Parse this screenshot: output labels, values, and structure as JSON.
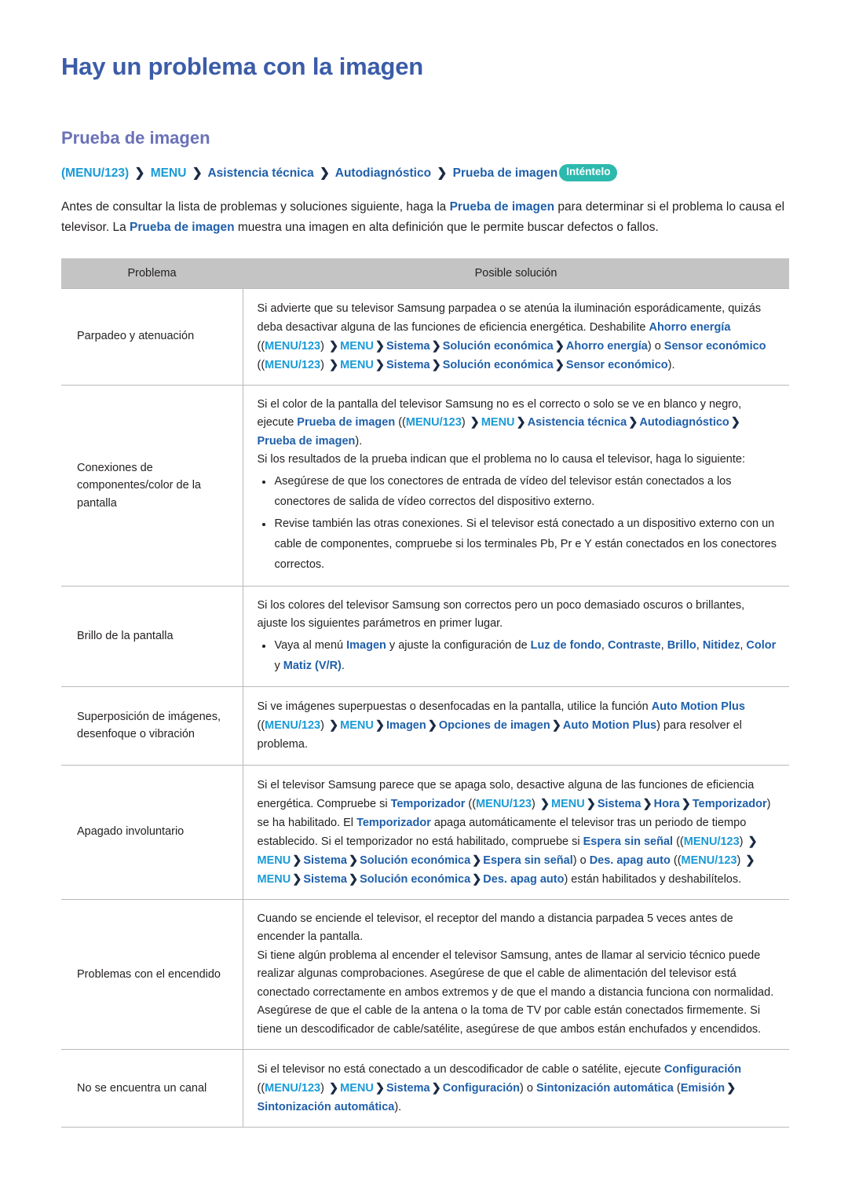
{
  "page": {
    "title": "Hay un problema con la imagen",
    "section_title": "Prueba de imagen"
  },
  "colors": {
    "title_blue": "#3b5ca8",
    "section_purple": "#6b72b8",
    "menu_teal": "#1a9bd7",
    "menu_blue": "#1f5faa",
    "badge_teal": "#2cb9ae",
    "table_header_gray": "#c4c4c4",
    "border_gray": "#b9b9b9"
  },
  "breadcrumb": {
    "menu123": "(MENU/123)",
    "menu": "MENU",
    "items": [
      "Asistencia técnica",
      "Autodiagnóstico",
      "Prueba de imagen"
    ],
    "chevron": "❯",
    "badge": "Inténtelo"
  },
  "intro": {
    "part1": "Antes de consultar la lista de problemas y soluciones siguiente, haga la ",
    "bold1": "Prueba de imagen",
    "part2": " para determinar si el problema lo causa el televisor. La ",
    "bold2": "Prueba de imagen",
    "part3": " muestra una imagen en alta definición que le permite buscar defectos o fallos."
  },
  "table": {
    "headers": {
      "problem": "Problema",
      "solution": "Posible solución"
    },
    "rows": [
      {
        "problem": "Parpadeo y atenuación",
        "solution": {
          "p1": "Si advierte que su televisor Samsung parpadea o se atenúa la iluminación esporádicamente, quizás deba desactivar alguna de las funciones de eficiencia energética. Deshabilite ",
          "b1": "Ahorro energía",
          "open1": " ((",
          "m1": "MENU/123",
          "close1": ") ",
          "menu1": "MENU",
          "path1_a": "Sistema",
          "path1_b": "Solución económica",
          "path1_c": "Ahorro energía",
          "mid": ") o ",
          "b2": "Sensor económico",
          "open2": " ((",
          "m2": "MENU/123",
          "close2": ") ",
          "menu2": "MENU",
          "path2_a": "Sistema",
          "path2_b": "Solución económica",
          "path2_c": "Sensor económico",
          "end": ")."
        }
      },
      {
        "problem": "Conexiones de componentes/color de la pantalla",
        "solution": {
          "p1": "Si el color de la pantalla del televisor Samsung no es el correcto o solo se ve en blanco y negro, ejecute ",
          "b1": "Prueba de imagen",
          "open1": " ((",
          "m1": "MENU/123",
          "close1": ") ",
          "menu1": "MENU",
          "path_a": "Asistencia técnica",
          "path_b": "Autodiagnóstico",
          "path_c": "Prueba de imagen",
          "end1": ").",
          "p2": "Si los resultados de la prueba indican que el problema no lo causa el televisor, haga lo siguiente:",
          "bullets": [
            "Asegúrese de que los conectores de entrada de vídeo del televisor están conectados a los conectores de salida de vídeo correctos del dispositivo externo.",
            "Revise también las otras conexiones. Si el televisor está conectado a un dispositivo externo con un cable de componentes, compruebe si los terminales Pb, Pr e Y están conectados en los conectores correctos."
          ]
        }
      },
      {
        "problem": "Brillo de la pantalla",
        "solution": {
          "p1": "Si los colores del televisor Samsung son correctos pero un poco demasiado oscuros o brillantes, ajuste los siguientes parámetros en primer lugar.",
          "bullet_pre": "Vaya al menú ",
          "b_imagen": "Imagen",
          "bullet_mid": " y ajuste la configuración de ",
          "b_luz": "Luz de fondo",
          "b_contraste": "Contraste",
          "b_brillo": "Brillo",
          "b_nitidez": "Nitidez",
          "b_color": "Color",
          "conj": " y ",
          "b_matiz": "Matiz (V/R)",
          "end": "."
        }
      },
      {
        "problem": "Superposición de imágenes, desenfoque o vibración",
        "solution": {
          "p1": "Si ve imágenes superpuestas o desenfocadas en la pantalla, utilice la función ",
          "b1": "Auto Motion Plus",
          "open1": " ((",
          "m1": "MENU/123",
          "close1": ") ",
          "menu1": "MENU",
          "path_a": "Imagen",
          "path_b": "Opciones de imagen",
          "path_c": "Auto Motion Plus",
          "end": ") para resolver el problema."
        }
      },
      {
        "problem": "Apagado involuntario",
        "solution": {
          "p1": "Si el televisor Samsung parece que se apaga solo, desactive alguna de las funciones de eficiencia energética. Compruebe si ",
          "b1": "Temporizador",
          "open1": " ((",
          "m1": "MENU/123",
          "close1": ") ",
          "menu1": "MENU",
          "path_a": "Sistema",
          "path_b": "Hora",
          "path_c": "Temporizador",
          "p2": ") se ha habilitado. El ",
          "b2": "Temporizador",
          "p3": " apaga automáticamente el televisor tras un periodo de tiempo establecido. Si el temporizador no está habilitado, compruebe si ",
          "b3": "Espera sin señal",
          "open2": " ((",
          "m2": "MENU/123",
          "close2": ") ",
          "menu2": "MENU",
          "path2_a": "Sistema",
          "path2_b": "Solución económica",
          "path2_c": "Espera sin señal",
          "p4": ") o ",
          "b4": "Des. apag auto",
          "open3": " ((",
          "m3": "MENU/123",
          "close3": ") ",
          "menu3": "MENU",
          "path3_a": "Sistema",
          "path3_b": "Solución económica",
          "path3_c": "Des. apag auto",
          "end": ") están habilitados y deshabilítelos."
        }
      },
      {
        "problem": "Problemas con el encendido",
        "solution": {
          "p1": "Cuando se enciende el televisor, el receptor del mando a distancia parpadea 5 veces antes de encender la pantalla.",
          "p2": "Si tiene algún problema al encender el televisor Samsung, antes de llamar al servicio técnico puede realizar algunas comprobaciones. Asegúrese de que el cable de alimentación del televisor está conectado correctamente en ambos extremos y de que el mando a distancia funciona con normalidad. Asegúrese de que el cable de la antena o la toma de TV por cable están conectados firmemente. Si tiene un descodificador de cable/satélite, asegúrese de que ambos están enchufados y encendidos."
        }
      },
      {
        "problem": "No se encuentra un canal",
        "solution": {
          "p1": "Si el televisor no está conectado a un descodificador de cable o satélite, ejecute ",
          "b1": "Configuración",
          "open1": " ((",
          "m1": "MENU/123",
          "close1": ") ",
          "menu1": "MENU",
          "path_a": "Sistema",
          "path_b": "Configuración",
          "p2": ") o ",
          "b2": "Sintonización automática",
          "open2": " (",
          "b_emision": "Emisión",
          "path2_a": "Sintonización automática",
          "end": ")."
        }
      }
    ]
  }
}
